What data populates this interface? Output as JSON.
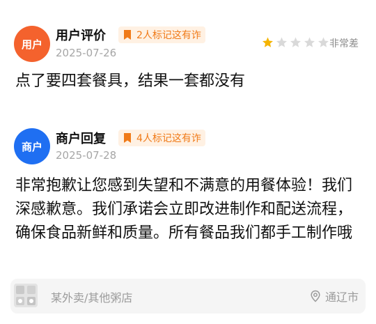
{
  "review": {
    "avatar_label": "用户",
    "author": "用户评价",
    "fraud_tag": "2人标记这有诈",
    "date": "2025-07-26",
    "rating_stars": 1,
    "rating_max": 5,
    "rating_text": "非常差",
    "content": "点了要四套餐具，结果一套都没有"
  },
  "reply": {
    "avatar_label": "商户",
    "author": "商户回复",
    "fraud_tag": "4人标记这有诈",
    "date": "2025-07-28",
    "content": "非常抱歉让您感到失望和不满意的用餐体验！我们深感歉意。我们承诺会立即改进制作和配送流程，确保食品新鲜和质量。所有餐品我们都手工制作哦"
  },
  "source": {
    "text": "某外卖/其他粥店",
    "location": "通辽市"
  },
  "colors": {
    "user_avatar": "#f4622d",
    "shop_avatar": "#1f6ff2",
    "tag_text": "#f07a18",
    "tag_bg": "#fff1e3",
    "star_on": "#f5b400",
    "star_off": "#d9d9d9"
  },
  "icons": {
    "tag": "bookmark-icon",
    "star": "star-icon",
    "location": "location-pin-icon"
  }
}
